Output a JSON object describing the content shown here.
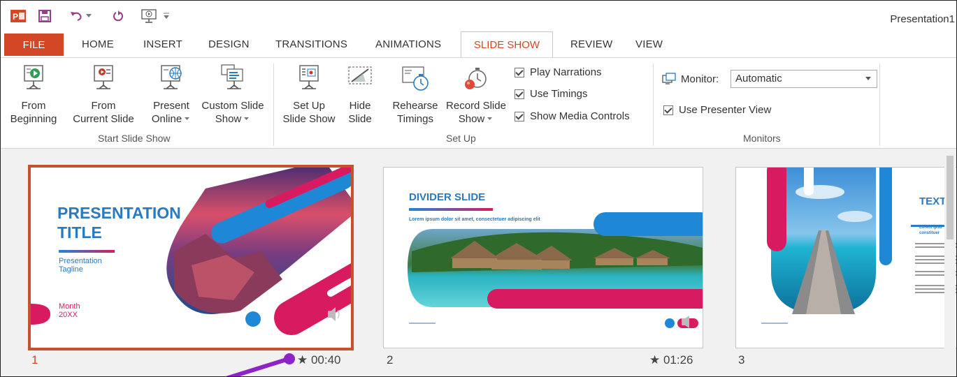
{
  "title_bar": {
    "app_title": "Presentation1",
    "qat_icons": [
      "powerpoint-logo-icon",
      "save-icon",
      "undo-icon",
      "redo-icon",
      "from-beginning-qat-icon",
      "customize-qat-icon"
    ]
  },
  "tabs": {
    "file": "FILE",
    "home": "HOME",
    "insert": "INSERT",
    "design": "DESIGN",
    "transitions": "TRANSITIONS",
    "animations": "ANIMATIONS",
    "slide_show": "SLIDE SHOW",
    "review": "REVIEW",
    "view": "VIEW"
  },
  "ribbon": {
    "start_slide_show": {
      "label": "Start Slide Show",
      "from_beginning": [
        "From",
        "Beginning"
      ],
      "from_current": [
        "From",
        "Current Slide"
      ],
      "present_online": [
        "Present",
        "Online"
      ],
      "custom_slide_show": [
        "Custom Slide",
        "Show"
      ]
    },
    "set_up": {
      "label": "Set Up",
      "set_up_slide_show": [
        "Set Up",
        "Slide Show"
      ],
      "hide_slide": [
        "Hide",
        "Slide"
      ],
      "rehearse_timings": [
        "Rehearse",
        "Timings"
      ],
      "record_slide_show": [
        "Record Slide",
        "Show"
      ],
      "play_narrations": "Play Narrations",
      "use_timings": "Use Timings",
      "show_media_controls": "Show Media Controls"
    },
    "monitors": {
      "label": "Monitors",
      "monitor_label": "Monitor:",
      "monitor_value": "Automatic",
      "use_presenter_view": "Use Presenter View"
    }
  },
  "colors": {
    "accent": "#d24726",
    "selected_border": "#c7512c",
    "brand_blue": "#1e88d6",
    "brand_pink": "#d81b60",
    "annotation_purple": "#8e24c8"
  },
  "slides": [
    {
      "number": "1",
      "time": "★ 00:40",
      "selected": true,
      "title_line1": "PRESENTATION",
      "title_line2": "TITLE",
      "tagline": "Presentation Tagline",
      "date_line1": "Month",
      "date_line2": "20XX"
    },
    {
      "number": "2",
      "time": "★ 01:26",
      "selected": false,
      "title": "DIVIDER SLIDE",
      "subtitle": "Lorem ipsum dolor sit amet, consectetuer adipiscing elit"
    },
    {
      "number": "3",
      "time": "",
      "selected": false,
      "title": "TEXT I",
      "subtitle": "Lorem ipsu constituer"
    }
  ]
}
